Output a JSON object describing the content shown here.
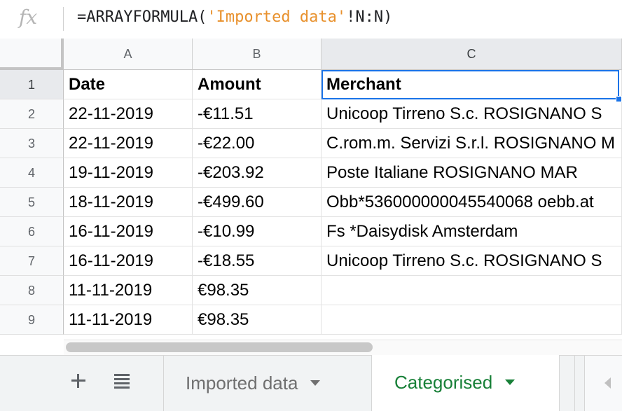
{
  "formula_bar": {
    "fx_label": "fx",
    "formula_prefix": "=ARRAYFORMULA(",
    "formula_string": "'Imported data'",
    "formula_suffix": "!N:N)"
  },
  "columns": [
    "A",
    "B",
    "C"
  ],
  "rows": [
    {
      "num": "1",
      "cells": [
        "Date",
        "Amount",
        "Merchant"
      ]
    },
    {
      "num": "2",
      "cells": [
        "22-11-2019",
        "-€11.51",
        "Unicoop Tirreno S.c. ROSIGNANO S"
      ]
    },
    {
      "num": "3",
      "cells": [
        "22-11-2019",
        "-€22.00",
        "C.rom.m. Servizi S.r.l. ROSIGNANO M"
      ]
    },
    {
      "num": "4",
      "cells": [
        "19-11-2019",
        "-€203.92",
        "Poste Italiane ROSIGNANO MAR"
      ]
    },
    {
      "num": "5",
      "cells": [
        "18-11-2019",
        "-€499.60",
        "Obb*536000000045540068 oebb.at"
      ]
    },
    {
      "num": "6",
      "cells": [
        "16-11-2019",
        "-€10.99",
        "Fs *Daisydisk Amsterdam"
      ]
    },
    {
      "num": "7",
      "cells": [
        "16-11-2019",
        "-€18.55",
        "Unicoop Tirreno S.c. ROSIGNANO S"
      ]
    },
    {
      "num": "8",
      "cells": [
        "11-11-2019",
        "€98.35",
        ""
      ]
    },
    {
      "num": "9",
      "cells": [
        "11-11-2019",
        "€98.35",
        ""
      ]
    }
  ],
  "sheet_tabs": [
    {
      "label": "Imported data",
      "active": false
    },
    {
      "label": "Categorised",
      "active": true
    }
  ],
  "icons": {
    "add_sheet": "plus-icon",
    "all_sheets": "list-icon",
    "scroll_left": "triangle-left-icon"
  },
  "colors": {
    "active_tab": "#188038",
    "selection": "#1a73e8",
    "formula_string": "#e8912d"
  }
}
